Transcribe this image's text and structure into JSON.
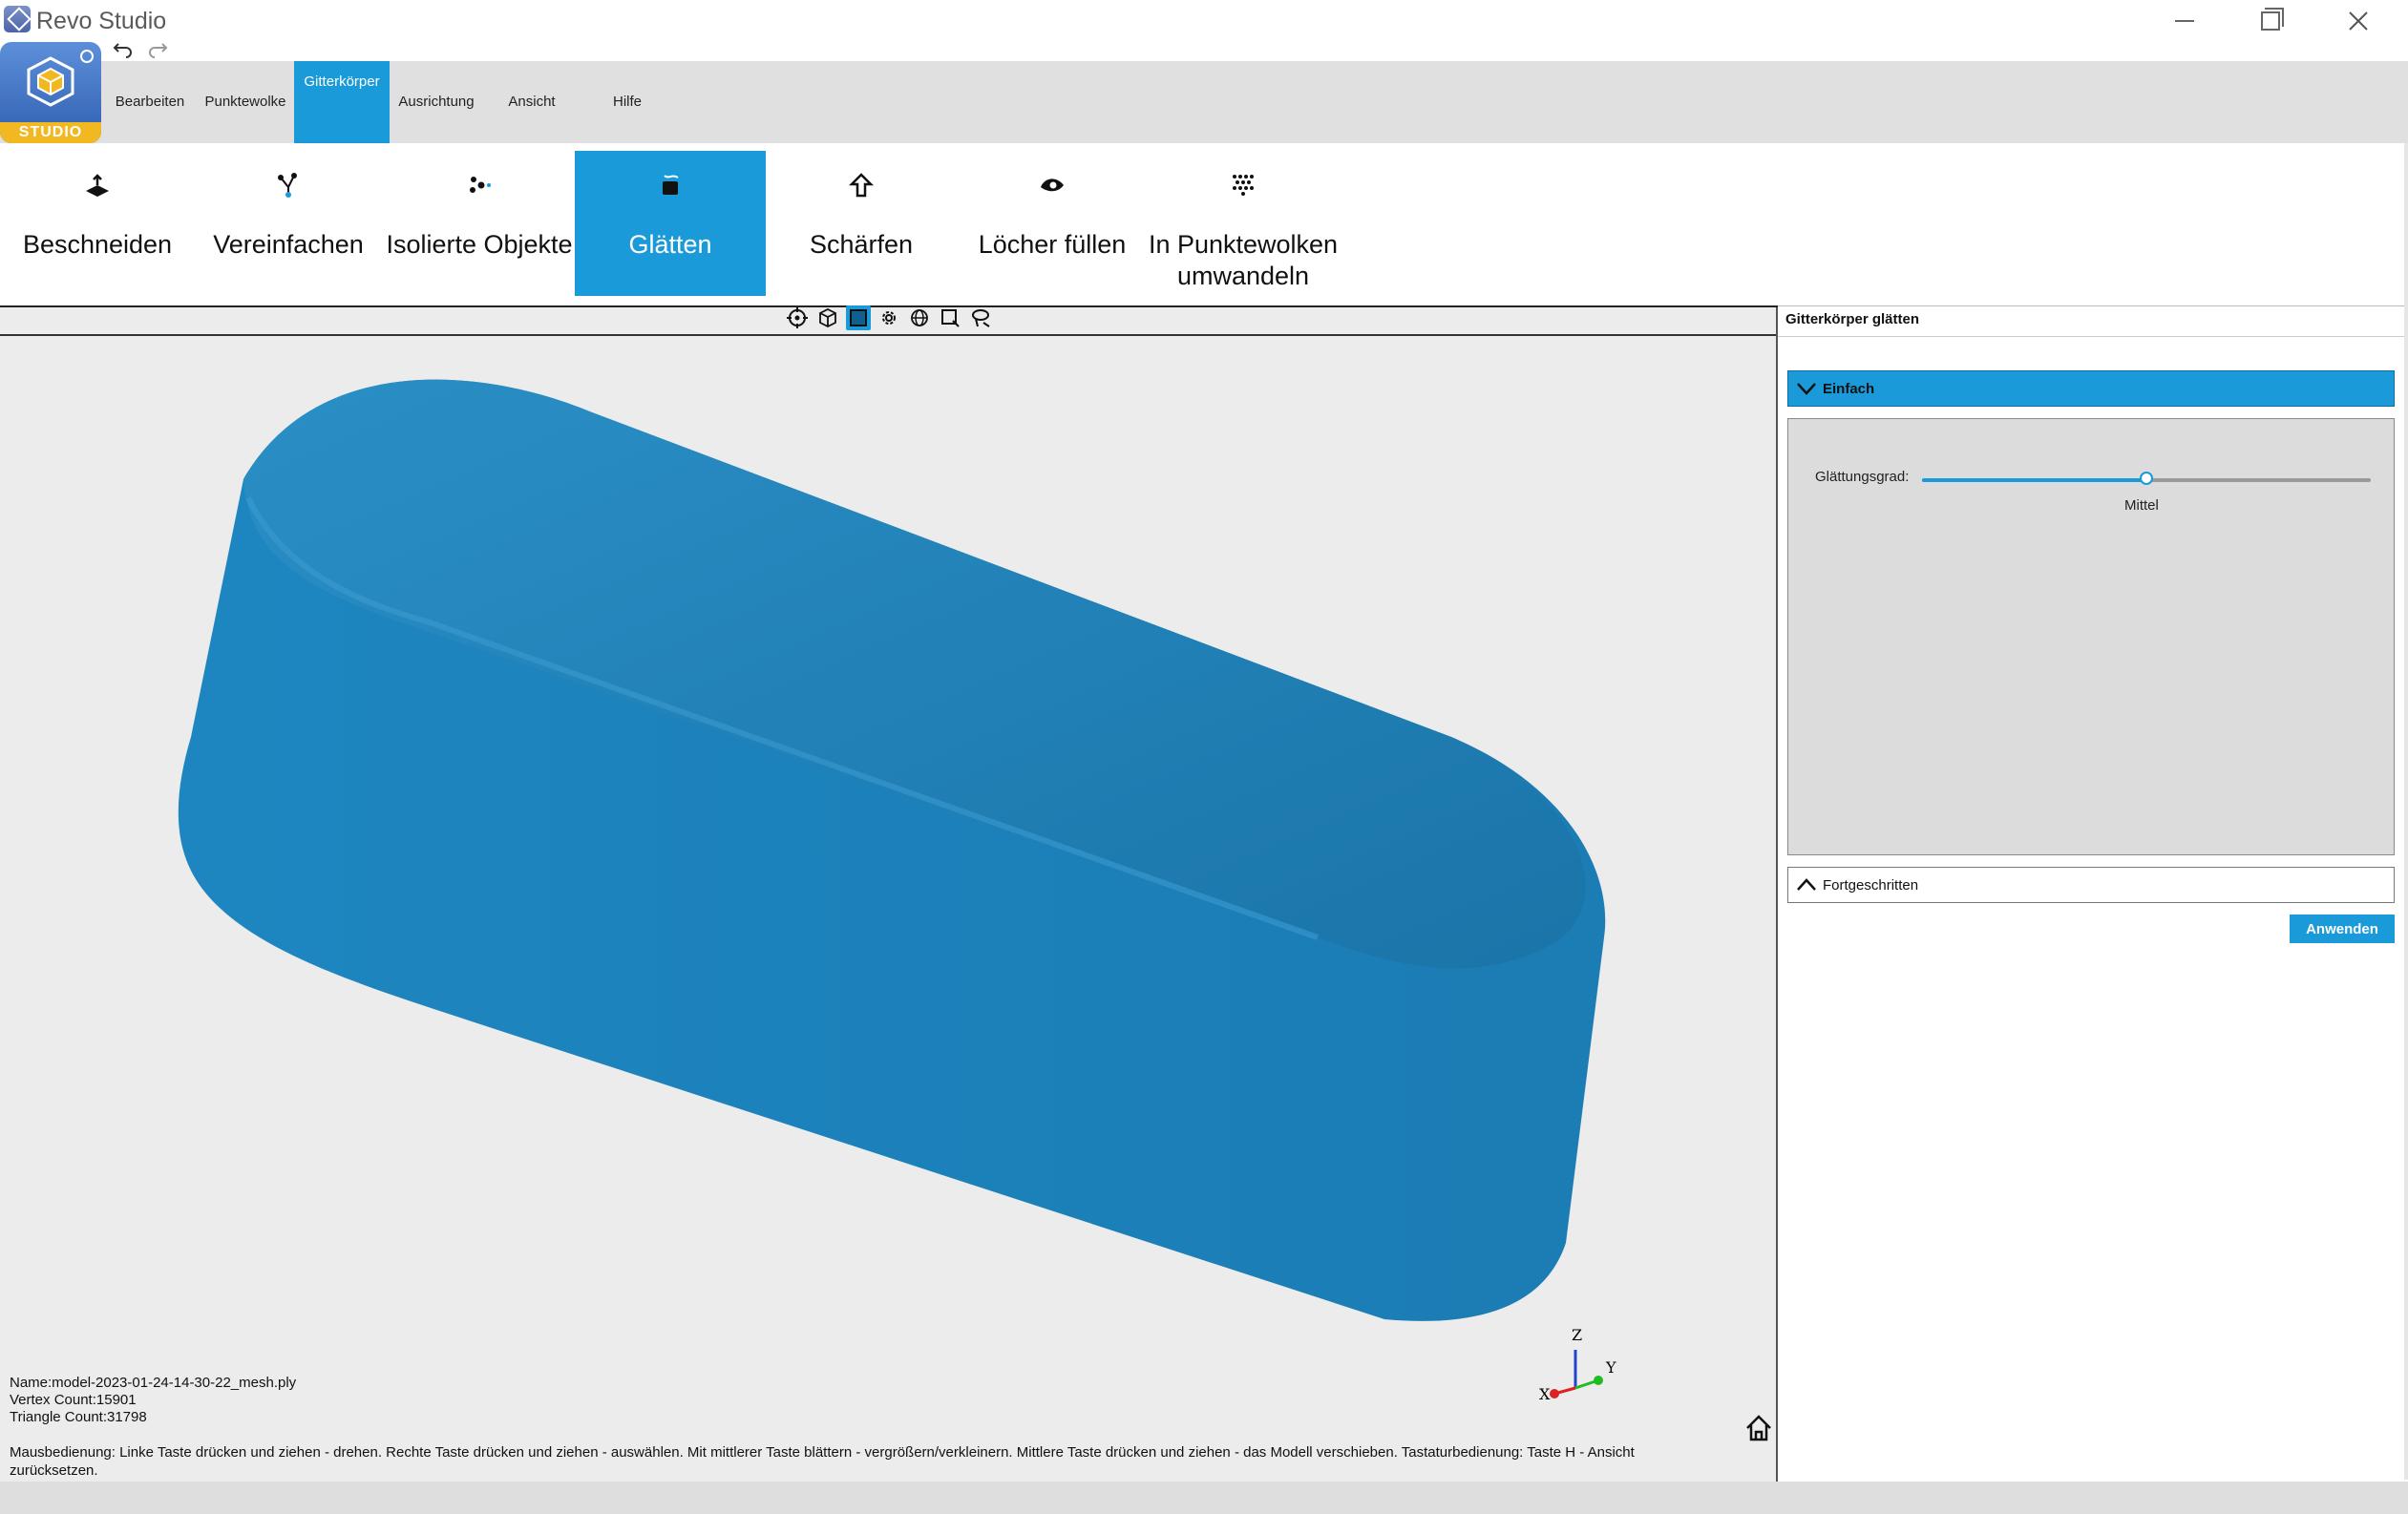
{
  "window": {
    "title": "Revo Studio",
    "minimize_icon": "minimize-icon",
    "maximize_icon": "restore-icon",
    "close_icon": "close-icon"
  },
  "quick_access": {
    "undo_icon": "undo-icon",
    "redo_icon": "redo-icon"
  },
  "logo": {
    "text": "STUDIO"
  },
  "menu": {
    "tabs": [
      {
        "label": "Bearbeiten"
      },
      {
        "label": "Punktewolke"
      },
      {
        "label": "Gitterkörper",
        "active": true
      },
      {
        "label": "Ausrichtung"
      },
      {
        "label": "Ansicht"
      },
      {
        "label": "Hilfe"
      }
    ]
  },
  "ribbon": {
    "buttons": [
      {
        "label": "Beschneiden",
        "icon": "trim-icon"
      },
      {
        "label": "Vereinfachen",
        "icon": "simplify-icon"
      },
      {
        "label": "Isolierte Objekte",
        "icon": "isolated-objects-icon"
      },
      {
        "label": "Glätten",
        "icon": "smooth-icon",
        "active": true
      },
      {
        "label": "Schärfen",
        "icon": "sharpen-icon"
      },
      {
        "label": "Löcher füllen",
        "icon": "fill-holes-icon"
      },
      {
        "label": "In Punktewolken umwandeln",
        "icon": "convert-to-pointcloud-icon"
      }
    ]
  },
  "view_toolbar": {
    "icons": [
      "center-view-icon",
      "cube-view-icon",
      "box-select-icon",
      "gear-view-icon",
      "globe-icon",
      "rect-select-icon",
      "lasso-select-icon"
    ]
  },
  "viewport": {
    "model_color": "#1f7fb3",
    "background": "#ececec",
    "info": {
      "name": "Name:model-2023-01-24-14-30-22_mesh.ply",
      "vertex_count": "Vertex Count:15901",
      "triangle_count": "Triangle Count:31798"
    },
    "axes": {
      "z": "Z",
      "y": "Y",
      "x": "X"
    },
    "home_icon": "home-icon"
  },
  "panel": {
    "title": "Gitterkörper glätten",
    "section_simple": "Einfach",
    "slider_label": "Glättungsgrad:",
    "slider_value_text": "Mittel",
    "slider_level": 0.5,
    "section_advanced": "Fortgeschritten",
    "apply": "Anwenden"
  },
  "help_text": "Mausbedienung: Linke Taste drücken und ziehen - drehen. Rechte Taste drücken und ziehen - auswählen. Mit mittlerer Taste blättern - vergrößern/verkleinern. Mittlere Taste drücken und ziehen - das Modell verschieben. Tastaturbedienung: Taste H - Ansicht zurücksetzen.",
  "colors": {
    "accent": "#1a9ad9",
    "menu_bg": "#e0e0e0"
  }
}
